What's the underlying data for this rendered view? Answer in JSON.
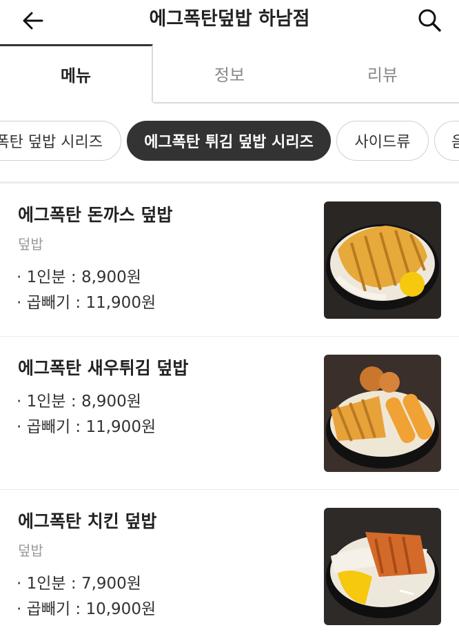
{
  "header": {
    "title": "에그폭탄덮밥 하남점",
    "back_icon": "arrow-left-icon",
    "search_icon": "search-icon"
  },
  "tabs": [
    {
      "label": "메뉴",
      "active": true
    },
    {
      "label": "정보",
      "active": false
    },
    {
      "label": "리뷰",
      "active": false
    }
  ],
  "categories": [
    {
      "label": "에그폭탄 덮밥 시리즈",
      "active": false
    },
    {
      "label": "에그폭탄 튀김 덮밥 시리즈",
      "active": true
    },
    {
      "label": "사이드류",
      "active": false
    },
    {
      "label": "음료",
      "active": false
    }
  ],
  "menu_items": [
    {
      "name": "에그폭탄 돈까스 덮밥",
      "category": "덮밥",
      "prices": [
        "· 1인분 : 8,900원",
        "· 곱빼기 : 11,900원"
      ],
      "image_icon": "pork-cutlet-rice-bowl-image"
    },
    {
      "name": "에그폭탄 새우튀김 덮밥",
      "prices": [
        "· 1인분 : 8,900원",
        "· 곱빼기 : 11,900원"
      ],
      "image_icon": "shrimp-tempura-rice-bowl-image"
    },
    {
      "name": "에그폭탄 치킨 덮밥",
      "category": "덮밥",
      "prices": [
        "· 1인분 : 7,900원",
        "· 곱빼기 : 10,900원"
      ],
      "image_icon": "chicken-rice-bowl-image"
    }
  ],
  "colors": {
    "active_chip": "#333333",
    "accent_text": "#222222",
    "muted_text": "#9a9a9a"
  }
}
